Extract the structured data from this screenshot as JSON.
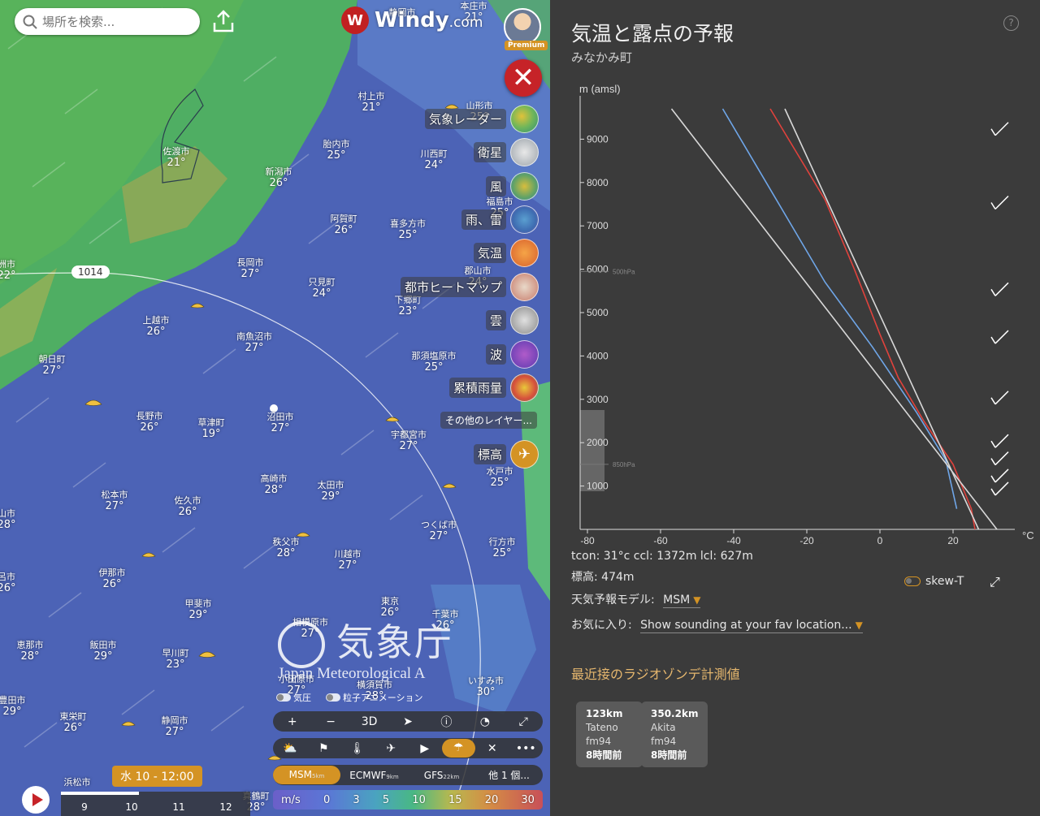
{
  "search": {
    "placeholder": "場所を検索..."
  },
  "logo": {
    "brand": "Windy",
    "suffix": ".com"
  },
  "account": {
    "badge": "Premium"
  },
  "cities": [
    {
      "name": "静岡市",
      "temp": "",
      "x": 495,
      "y": 10
    },
    {
      "name": "本庄市",
      "temp": "21°",
      "x": 583,
      "y": 2
    },
    {
      "name": "村上市",
      "temp": "21°",
      "x": 457,
      "y": 113
    },
    {
      "name": "山形市",
      "temp": "25°",
      "x": 590,
      "y": 125
    },
    {
      "name": "佐渡市",
      "temp": "21°",
      "x": 217,
      "y": 181
    },
    {
      "name": "胎内市",
      "temp": "25°",
      "x": 414,
      "y": 172
    },
    {
      "name": "川西町",
      "temp": "24°",
      "x": 534,
      "y": 184
    },
    {
      "name": "新潟市",
      "temp": "26°",
      "x": 343,
      "y": 206
    },
    {
      "name": "福島市",
      "temp": "25°",
      "x": 615,
      "y": 243
    },
    {
      "name": "阿賀町",
      "temp": "26°",
      "x": 423,
      "y": 264
    },
    {
      "name": "喜多方市",
      "temp": "25°",
      "x": 502,
      "y": 270
    },
    {
      "name": "長岡市",
      "temp": "27°",
      "x": 308,
      "y": 318
    },
    {
      "name": "郡山市",
      "temp": "24°",
      "x": 588,
      "y": 328
    },
    {
      "name": "只見町",
      "temp": "24°",
      "x": 396,
      "y": 342
    },
    {
      "name": "下郷町",
      "temp": "23°",
      "x": 502,
      "y": 364
    },
    {
      "name": "上越市",
      "temp": "26°",
      "x": 192,
      "y": 389
    },
    {
      "name": "南魚沼市",
      "temp": "27°",
      "x": 313,
      "y": 409
    },
    {
      "name": "朝日町",
      "temp": "27°",
      "x": 64,
      "y": 437
    },
    {
      "name": "那須塩原市",
      "temp": "25°",
      "x": 534,
      "y": 433
    },
    {
      "name": "長野市",
      "temp": "26°",
      "x": 184,
      "y": 507
    },
    {
      "name": "草津町",
      "temp": "19°",
      "x": 260,
      "y": 515
    },
    {
      "name": "沼田市",
      "temp": "27°",
      "x": 345,
      "y": 508
    },
    {
      "name": "宇都宮市",
      "temp": "27°",
      "x": 503,
      "y": 530
    },
    {
      "name": "水戸市",
      "temp": "25°",
      "x": 615,
      "y": 575
    },
    {
      "name": "高崎市",
      "temp": "28°",
      "x": 337,
      "y": 584
    },
    {
      "name": "太田市",
      "temp": "29°",
      "x": 407,
      "y": 592
    },
    {
      "name": "松本市",
      "temp": "27°",
      "x": 141,
      "y": 604
    },
    {
      "name": "佐久市",
      "temp": "26°",
      "x": 231,
      "y": 611
    },
    {
      "name": "つくば市",
      "temp": "27°",
      "x": 540,
      "y": 641
    },
    {
      "name": "行方市",
      "temp": "25°",
      "x": 618,
      "y": 662
    },
    {
      "name": "秩父市",
      "temp": "28°",
      "x": 352,
      "y": 662
    },
    {
      "name": "川越市",
      "temp": "27°",
      "x": 428,
      "y": 677
    },
    {
      "name": "伊那市",
      "temp": "26°",
      "x": 138,
      "y": 700
    },
    {
      "name": "東京",
      "temp": "26°",
      "x": 480,
      "y": 735
    },
    {
      "name": "千葉市",
      "temp": "26°",
      "x": 548,
      "y": 751
    },
    {
      "name": "甲斐市",
      "temp": "29°",
      "x": 244,
      "y": 738
    },
    {
      "name": "相模原市",
      "temp": "27°",
      "x": 382,
      "y": 761
    },
    {
      "name": "飯田市",
      "temp": "29°",
      "x": 127,
      "y": 789
    },
    {
      "name": "恵那市",
      "temp": "28°",
      "x": 37,
      "y": 789
    },
    {
      "name": "早川町",
      "temp": "23°",
      "x": 216,
      "y": 799
    },
    {
      "name": "小田原市",
      "temp": "27°",
      "x": 365,
      "y": 831
    },
    {
      "name": "横須賀市",
      "temp": "28°",
      "x": 461,
      "y": 838
    },
    {
      "name": "いすみ市",
      "temp": "30°",
      "x": 598,
      "y": 833
    },
    {
      "name": "豊田市",
      "temp": "29°",
      "x": 15,
      "y": 857
    },
    {
      "name": "東栄町",
      "temp": "26°",
      "x": 90,
      "y": 877
    },
    {
      "name": "静岡市",
      "temp": "27°",
      "x": 215,
      "y": 882
    },
    {
      "name": "浜松市",
      "temp": "",
      "x": 95,
      "y": 958
    },
    {
      "name": "真鶴町",
      "temp": "28°",
      "x": 315,
      "y": 975
    },
    {
      "name": "洲市",
      "temp": "22°",
      "x": 8,
      "y": 320
    },
    {
      "name": "山市",
      "temp": "28°",
      "x": 8,
      "y": 627
    },
    {
      "name": "呂市",
      "temp": "26°",
      "x": 8,
      "y": 705
    }
  ],
  "layers": [
    {
      "label": "気象レーダー",
      "top": 0,
      "color": "radial-gradient(circle at 40% 40%, #e0c23a, #6fb65a 50%, #2f8f7a)"
    },
    {
      "label": "衛星",
      "top": 41,
      "color": "radial-gradient(circle at 50% 50%, #e8e8e8, #9ca4ab)"
    },
    {
      "label": "風",
      "top": 83,
      "color": "radial-gradient(circle at 50% 50%, #d8bd3d, #5fa267 60%, #3d7bb2)"
    },
    {
      "label": "雨、雷",
      "top": 124,
      "color": "radial-gradient(circle at 50% 50%, #5a9fd0, #3e6cb1 60%, #7a5cb0)"
    },
    {
      "label": "気温",
      "top": 165,
      "color": "radial-gradient(circle at 50% 50%, #f5a447, #d8602c)"
    },
    {
      "label": "都市ヒートマップ",
      "top": 207,
      "color": "radial-gradient(circle at 50% 50%, #e8d8c8, #c77a6a)"
    },
    {
      "label": "雲",
      "top": 248,
      "color": "radial-gradient(circle at 50% 50%, #e0e0e0, #8a8a8a)"
    },
    {
      "label": "波",
      "top": 290,
      "color": "radial-gradient(circle at 50% 50%, #b05bc9, #5b3ab0)"
    },
    {
      "label": "累積雨量",
      "top": 331,
      "color": "radial-gradient(circle at 50% 50%, #e8c83a, #d64d3c 60%, #5aa05a)"
    }
  ],
  "more_layers": "その他のレイヤー...",
  "elevation_label": "標高",
  "pressure_label": "1014",
  "jma": {
    "jp": "気象庁",
    "en": "Japan Meteorological A"
  },
  "map_toggles": {
    "pressure": "気圧",
    "particles": "粒子アニメーション"
  },
  "toolbar1": [
    "+",
    "−",
    "3D",
    "➤",
    "ⓘ",
    "◔",
    "⤢"
  ],
  "toolbar2": [
    "⛅",
    "⚑",
    "🌡",
    "✈",
    "▶",
    "☂",
    "✕",
    "•••"
  ],
  "models": [
    {
      "name": "MSM",
      "res": "5km"
    },
    {
      "name": "ECMWF",
      "res": "9km"
    },
    {
      "name": "GFS",
      "res": "22km"
    },
    {
      "name": "他 1 個...",
      "res": ""
    }
  ],
  "legend": [
    "m/s",
    "0",
    "3",
    "5",
    "10",
    "15",
    "20",
    "30"
  ],
  "time_badge": "水 10 - 12:00",
  "timeline_progress": 0.41,
  "timeline_hours": [
    "9",
    "10",
    "11",
    "12"
  ],
  "panel": {
    "title": "気温と露点の予報",
    "location": "みなかみ町",
    "help": "?",
    "info1": "tcon: 31°c ccl: 1372m lcl: 627m",
    "info2": "標高: 474m",
    "skew_label": "skew-T",
    "model_label": "天気予報モデル:",
    "model_value": "MSM",
    "fav_label": "お気に入り:",
    "fav_value": "Show sounding at your fav location...",
    "radiosonde_title": "最近接のラジオゾンデ計測値",
    "stations": [
      {
        "dist": "123km",
        "name": "Tateno",
        "model": "fm94",
        "ago": "8時間前"
      },
      {
        "dist": "350.2km",
        "name": "Akita",
        "model": "fm94",
        "ago": "8時間前"
      }
    ]
  },
  "chart_data": {
    "type": "line",
    "ylabel": "m (amsl)",
    "xlabel": "°C",
    "x_ticks": [
      -80,
      -60,
      -40,
      -20,
      0,
      20
    ],
    "y_ticks": [
      1000,
      2000,
      3000,
      4000,
      5000,
      6000,
      7000,
      8000,
      9000
    ],
    "pressure_marks": [
      {
        "label": "500hPa",
        "alt": 5950
      },
      {
        "label": "850hPa",
        "alt": 1500
      }
    ],
    "xlim": [
      -82,
      38
    ],
    "ylim": [
      0,
      10000
    ],
    "series": [
      {
        "color": "#e0423c",
        "points": [
          [
            26,
            0
          ],
          [
            25,
            474
          ],
          [
            20,
            1500
          ],
          [
            12,
            2500
          ],
          [
            5,
            3500
          ],
          [
            0,
            4500
          ],
          [
            -7,
            6000
          ],
          [
            -15,
            7600
          ],
          [
            -30,
            9700
          ]
        ]
      },
      {
        "color": "#6fa6e8",
        "points": [
          [
            21,
            474
          ],
          [
            18,
            1600
          ],
          [
            10,
            2700
          ],
          [
            -2,
            4200
          ],
          [
            -15,
            5700
          ],
          [
            -29,
            7700
          ],
          [
            -43,
            9700
          ]
        ]
      },
      {
        "color": "#d8d8d8",
        "points": [
          [
            32,
            0
          ],
          [
            -57,
            9700
          ]
        ]
      },
      {
        "color": "#d8d8d8",
        "points": [
          [
            27,
            0
          ],
          [
            -26,
            9700
          ]
        ]
      }
    ],
    "wind_barbs": [
      9200,
      7500,
      5500,
      4400,
      3000,
      2000,
      1600,
      1200,
      900
    ]
  }
}
